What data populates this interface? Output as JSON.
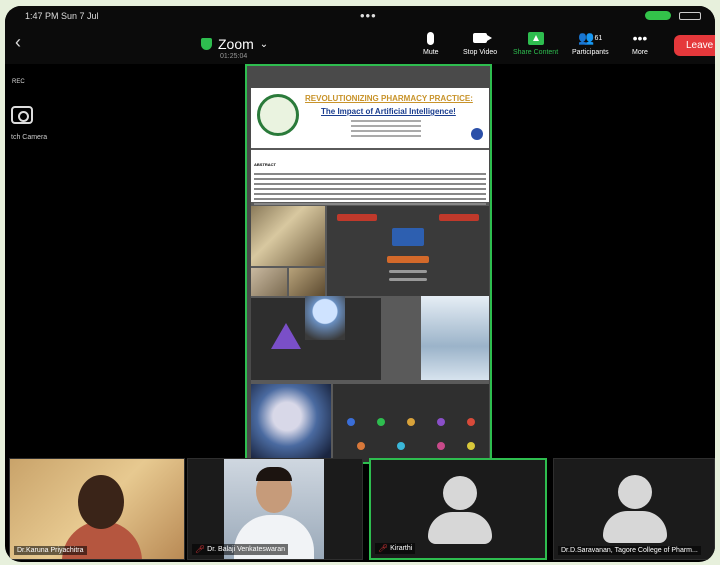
{
  "status_bar": {
    "time_date": "1:47 PM  Sun 7 Jul",
    "dots": "•••"
  },
  "header": {
    "app_title": "Zoom",
    "timer": "01:25:04",
    "buttons": {
      "mute": "Mute",
      "stop_video": "Stop Video",
      "share_content": "Share Content",
      "participants": "Participants",
      "participants_count": "61",
      "more": "More",
      "leave": "Leave"
    }
  },
  "left_panel": {
    "rec": "REC",
    "switch_camera": "tch Camera"
  },
  "poster": {
    "title_line1": "REVOLUTIONIZING PHARMACY PRACTICE:",
    "title_line2": "The Impact of Artificial Intelligence!",
    "abstract_label": "ABSTRACT"
  },
  "participants": [
    {
      "name": "Dr.Karuna Priyachitra"
    },
    {
      "name": "Dr. Balaji Venkateswaran"
    },
    {
      "name": "Kirarthi"
    },
    {
      "name": "Dr.D.Saravanan, Tagore College of Pharm..."
    }
  ],
  "colors": {
    "accent": "#2ebd4f",
    "leave": "#e5383b",
    "title_gold": "#c8932a",
    "title_blue": "#1a3d8f"
  }
}
